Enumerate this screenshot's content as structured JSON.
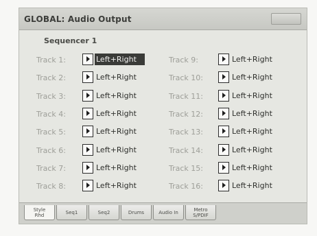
{
  "title": "GLOBAL: Audio Output",
  "section": "Sequencer 1",
  "tracks_left": [
    {
      "label": "Track 1:",
      "value": "Left+Right",
      "selected": true
    },
    {
      "label": "Track 2:",
      "value": "Left+Right"
    },
    {
      "label": "Track 3:",
      "value": "Left+Right"
    },
    {
      "label": "Track 4:",
      "value": "Left+Right"
    },
    {
      "label": "Track 5:",
      "value": "Left+Right"
    },
    {
      "label": "Track 6:",
      "value": "Left+Right"
    },
    {
      "label": "Track 7:",
      "value": "Left+Right"
    },
    {
      "label": "Track 8:",
      "value": "Left+Right"
    }
  ],
  "tracks_right": [
    {
      "label": "Track 9:",
      "value": "Left+Right"
    },
    {
      "label": "Track 10:",
      "value": "Left+Right"
    },
    {
      "label": "Track 11:",
      "value": "Left+Right"
    },
    {
      "label": "Track 12:",
      "value": "Left+Right"
    },
    {
      "label": "Track 13:",
      "value": "Left+Right"
    },
    {
      "label": "Track 14:",
      "value": "Left+Right"
    },
    {
      "label": "Track 15:",
      "value": "Left+Right"
    },
    {
      "label": "Track 16:",
      "value": "Left+Right"
    }
  ],
  "tabs": [
    {
      "label": "Style\nRhd",
      "active": true
    },
    {
      "label": "Seq1"
    },
    {
      "label": "Seq2"
    },
    {
      "label": "Drums"
    },
    {
      "label": "Audio In"
    },
    {
      "label": "Metro\nS/PDIF"
    }
  ]
}
